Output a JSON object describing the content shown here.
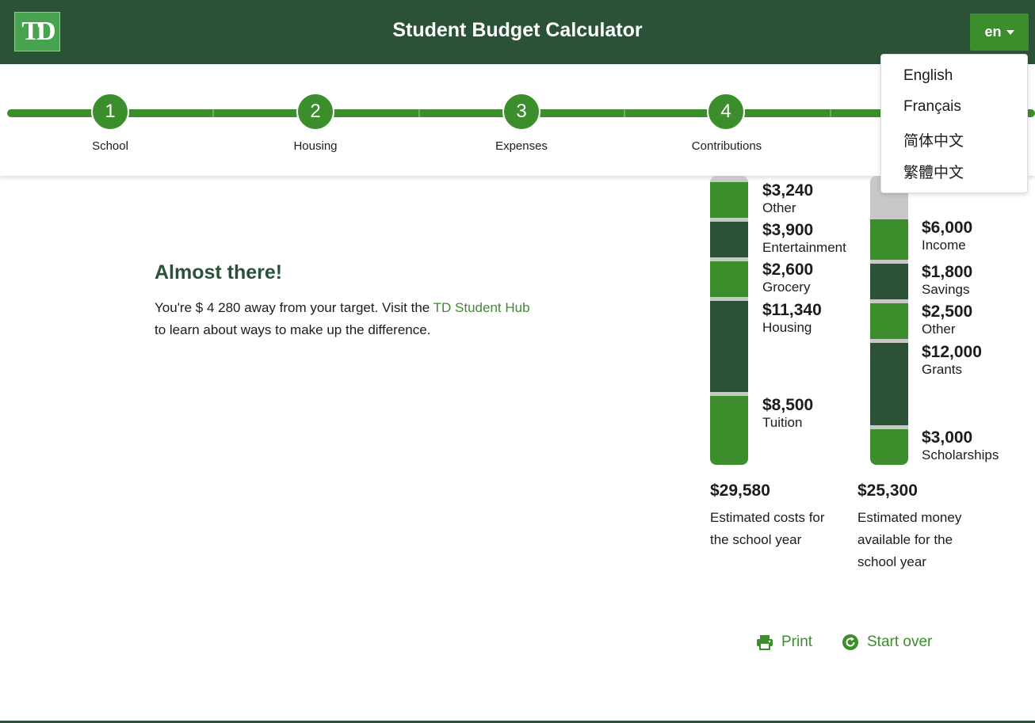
{
  "header": {
    "logo_text": "TD",
    "title": "Student Budget Calculator",
    "language_button": "en"
  },
  "language_menu": {
    "items": [
      "English",
      "Français",
      "简体中文",
      "繁體中文"
    ]
  },
  "stepper": {
    "steps": [
      {
        "number": "1",
        "label": "School"
      },
      {
        "number": "2",
        "label": "Housing"
      },
      {
        "number": "3",
        "label": "Expenses"
      },
      {
        "number": "4",
        "label": "Contributions"
      }
    ]
  },
  "message": {
    "title": "Almost there!",
    "text_before": "You're $ 4 280 away from your target. Visit the ",
    "link": "TD Student Hub",
    "text_after": " to learn about ways to make up the difference."
  },
  "costs": {
    "segments": [
      {
        "amount": "$3,240",
        "label": "Other"
      },
      {
        "amount": "$3,900",
        "label": "Entertainment"
      },
      {
        "amount": "$2,600",
        "label": "Grocery"
      },
      {
        "amount": "$11,340",
        "label": "Housing"
      },
      {
        "amount": "$8,500",
        "label": "Tuition"
      }
    ],
    "total": "$29,580",
    "description": "Estimated costs for the school year"
  },
  "funds": {
    "segments": [
      {
        "amount": "$6,000",
        "label": "Income"
      },
      {
        "amount": "$1,800",
        "label": "Savings"
      },
      {
        "amount": "$2,500",
        "label": "Other"
      },
      {
        "amount": "$12,000",
        "label": "Grants"
      },
      {
        "amount": "$3,000",
        "label": "Scholarships"
      }
    ],
    "total": "$25,300",
    "description": "Estimated money available for the school year"
  },
  "actions": {
    "print": "Print",
    "start_over": "Start over"
  },
  "colors": {
    "dark_green": "#2b5237",
    "bright_green": "#3c8d2c",
    "gap_gray": "#c8c8c8"
  },
  "icons": {
    "print": "printer-icon",
    "start_over": "restart-icon",
    "language": "chevron-down-icon"
  }
}
